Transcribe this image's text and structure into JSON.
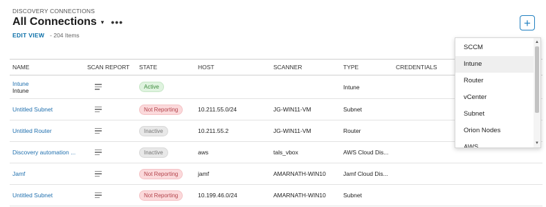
{
  "header": {
    "eyebrow": "DISCOVERY CONNECTIONS",
    "title": "All Connections",
    "caret": "▾",
    "more": "•••",
    "edit_view": "EDIT VIEW",
    "item_count": "- 204 Items",
    "add_symbol": "+"
  },
  "table": {
    "columns": [
      "NAME",
      "SCAN REPORT",
      "STATE",
      "HOST",
      "SCANNER",
      "TYPE",
      "CREDENTIALS"
    ],
    "rows": [
      {
        "name": "Intune",
        "name_sub": "Intune",
        "state": "Active",
        "host": "",
        "scanner": "",
        "type": "Intune",
        "credentials": ""
      },
      {
        "name": "Untitled Subnet",
        "state": "Not Reporting",
        "host": "10.211.55.0/24",
        "scanner": "JG-WIN11-VM",
        "type": "Subnet",
        "credentials": ""
      },
      {
        "name": "Untitled Router",
        "state": "Inactive",
        "host": "10.211.55.2",
        "scanner": "JG-WIN11-VM",
        "type": "Router",
        "credentials": ""
      },
      {
        "name": "Discovery automation ...",
        "state": "Inactive",
        "host": "aws",
        "scanner": "tals_vbox",
        "type": "AWS Cloud Dis...",
        "credentials": ""
      },
      {
        "name": "Jamf",
        "state": "Not Reporting",
        "host": "jamf",
        "scanner": "AMARNATH-WIN10",
        "type": "Jamf Cloud Dis...",
        "credentials": ""
      },
      {
        "name": "Untitled Subnet",
        "state": "Not Reporting",
        "host": "10.199.46.0/24",
        "scanner": "AMARNATH-WIN10",
        "type": "Subnet",
        "credentials": ""
      }
    ]
  },
  "dropdown": {
    "items": [
      "SCCM",
      "Intune",
      "Router",
      "vCenter",
      "Subnet",
      "Orion Nodes",
      "AWS"
    ],
    "hovered": "Intune"
  },
  "colors": {
    "link": "#1f6fae",
    "active": "#3d8a3d",
    "not_reporting": "#b3434b",
    "inactive": "#777777"
  }
}
